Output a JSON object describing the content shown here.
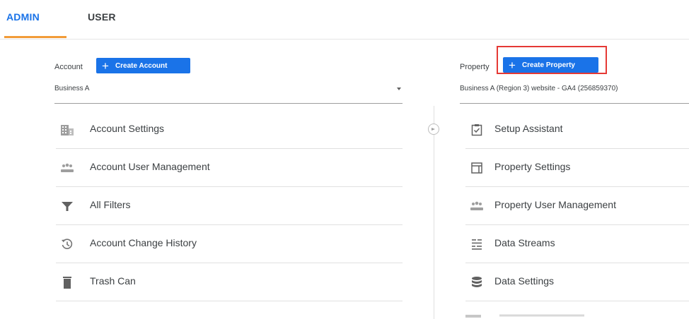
{
  "tabs": [
    {
      "label": "ADMIN",
      "active": true
    },
    {
      "label": "USER",
      "active": false
    }
  ],
  "colors": {
    "accent": "#1a73e8",
    "tab_underline": "#f29b38",
    "highlight": "#e53935"
  },
  "account": {
    "label": "Account",
    "create_label": "Create Account",
    "selected": "Business A",
    "items": [
      {
        "label": "Account Settings",
        "icon": "building-icon"
      },
      {
        "label": "Account User Management",
        "icon": "people-icon"
      },
      {
        "label": "All Filters",
        "icon": "filter-icon"
      },
      {
        "label": "Account Change History",
        "icon": "history-icon"
      },
      {
        "label": "Trash Can",
        "icon": "trash-icon"
      }
    ]
  },
  "property": {
    "label": "Property",
    "create_label": "Create Property",
    "selected": "Business A (Region 3) website - GA4 (256859370)",
    "items": [
      {
        "label": "Setup Assistant",
        "icon": "clipboard-check-icon"
      },
      {
        "label": "Property Settings",
        "icon": "layout-icon"
      },
      {
        "label": "Property User Management",
        "icon": "people-icon"
      },
      {
        "label": "Data Streams",
        "icon": "streams-icon"
      },
      {
        "label": "Data Settings",
        "icon": "database-icon"
      }
    ]
  }
}
